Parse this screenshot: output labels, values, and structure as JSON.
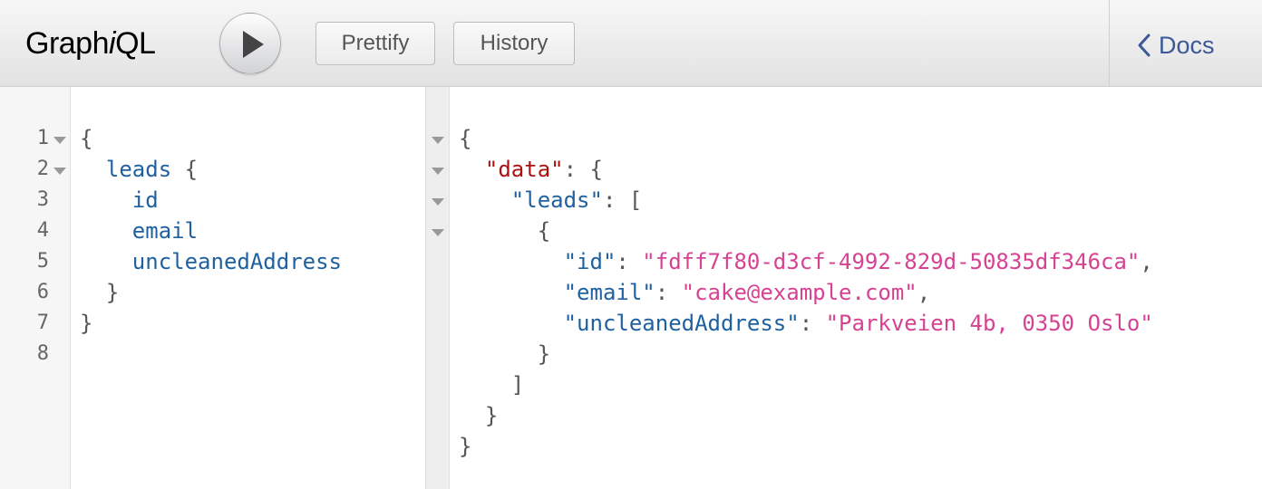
{
  "app": {
    "logo_prefix": "Graph",
    "logo_i": "i",
    "logo_suffix": "QL"
  },
  "toolbar": {
    "prettify_label": "Prettify",
    "history_label": "History",
    "docs_label": "Docs"
  },
  "query_editor": {
    "line_numbers": [
      "1",
      "2",
      "3",
      "4",
      "5",
      "6",
      "7",
      "8"
    ],
    "lines": {
      "l1": "{",
      "l2_field": "leads",
      "l2_brace": "{",
      "l3": "id",
      "l4": "email",
      "l5": "uncleanedAddress",
      "l6": "}",
      "l7": "}"
    }
  },
  "result_viewer": {
    "open_brace": "{",
    "data_key": "\"data\"",
    "colon_brace": ": {",
    "leads_key": "\"leads\"",
    "colon_bracket": ": [",
    "obj_open": "{",
    "id_key": "\"id\"",
    "id_value": "\"fdff7f80-d3cf-4992-829d-50835df346ca\"",
    "email_key": "\"email\"",
    "email_value": "\"cake@example.com\"",
    "address_key": "\"uncleanedAddress\"",
    "address_value": "\"Parkveien 4b, 0350 Oslo\"",
    "obj_close": "}",
    "array_close": "]",
    "data_close": "}",
    "root_close": "}",
    "colon": ": ",
    "comma": ","
  },
  "colors": {
    "field": "#1f61a0",
    "string": "#d64292",
    "json_key_data": "#a11",
    "docs_link": "#3b5998"
  },
  "icons": [
    "play-icon",
    "chevron-left-icon",
    "fold-arrow-icon"
  ]
}
